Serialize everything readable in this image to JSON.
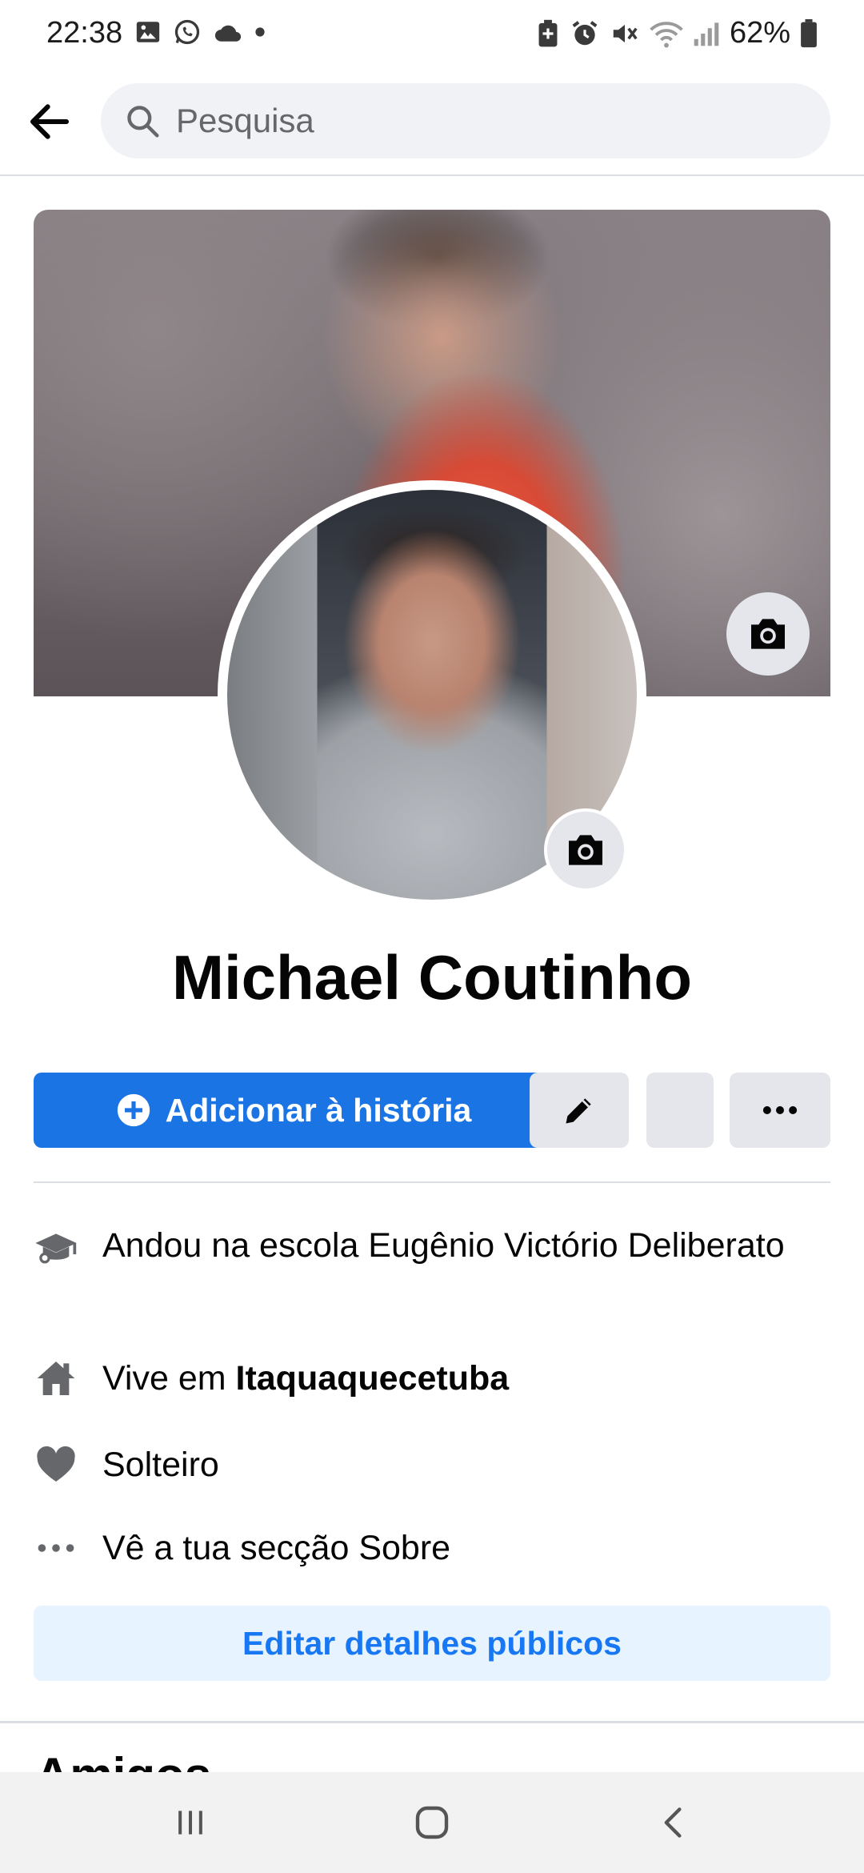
{
  "status_bar": {
    "time": "22:38",
    "battery_percent": "62%",
    "left_icons": [
      "gallery-icon",
      "whatsapp-icon",
      "cloud-icon",
      "dot-icon"
    ],
    "right_icons": [
      "battery-saver-icon",
      "alarm-icon",
      "mute-icon",
      "wifi-icon",
      "signal-icon",
      "battery-icon"
    ]
  },
  "search": {
    "placeholder": "Pesquisa"
  },
  "profile": {
    "name": "Michael Coutinho"
  },
  "actions": {
    "add_story_label": "Adicionar à história",
    "edit_icon": "pencil-icon",
    "more_icon": "more-icon"
  },
  "details": {
    "school": "Andou na escola Eugênio Victório Deliberato",
    "lives_prefix": "Vive em ",
    "lives_city": "Itaquaquecetuba",
    "relationship": "Solteiro",
    "about_link": "Vê a tua secção Sobre"
  },
  "edit_public_details_label": "Editar detalhes públicos",
  "next_section_peek": "Amigos",
  "colors": {
    "primary": "#1b74e4",
    "secondary_bg": "#e4e6eb",
    "link_bg": "#e7f3ff",
    "link_text": "#1877f2"
  }
}
